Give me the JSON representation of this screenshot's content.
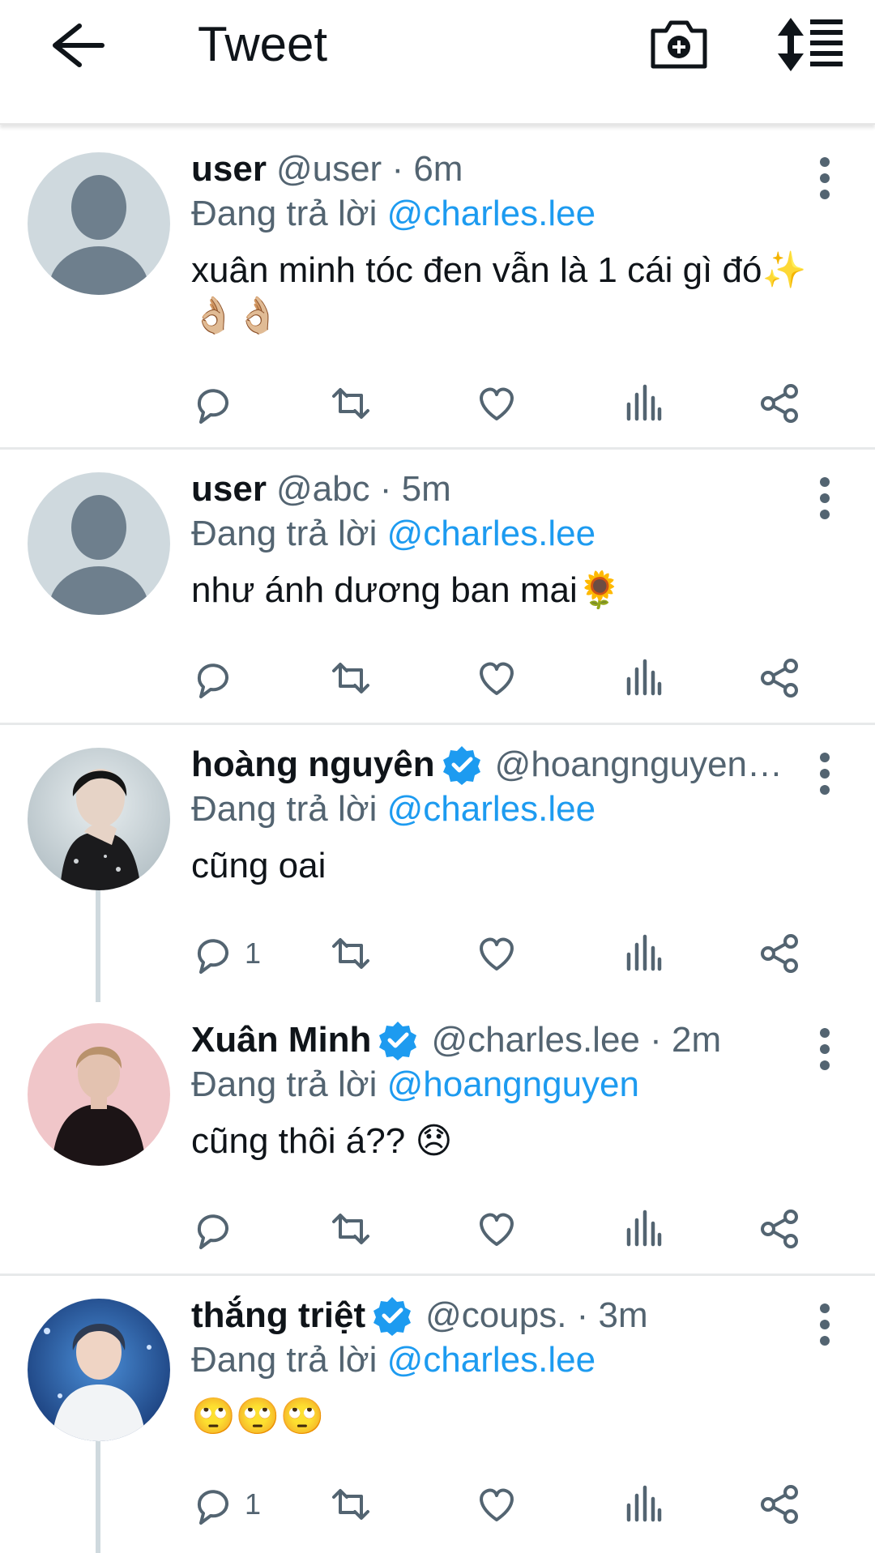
{
  "header": {
    "title": "Tweet",
    "back_icon": "arrow-left-icon",
    "camera_icon": "camera-plus-icon",
    "sort_icon": "sort-list-icon"
  },
  "colors": {
    "accent": "#1d9bf0",
    "secondary_text": "#536471",
    "primary_text": "#0f1419",
    "divider": "#e7e9ea"
  },
  "tweets": [
    {
      "name": "user",
      "handle": "@user · 6m",
      "verified": false,
      "replying_prefix": "Đang trả lời",
      "replying_to": "@charles.lee",
      "text": "xuân minh tóc đen vẫn là 1 cái gì đó✨👌🏼👌🏼",
      "reply_count": "",
      "avatar": "default-avatar"
    },
    {
      "name": "user",
      "handle": "@abc · 5m",
      "verified": false,
      "replying_prefix": "Đang trả lời",
      "replying_to": "@charles.lee",
      "text": "như ánh dương ban mai🌻",
      "reply_count": "",
      "avatar": "default-avatar"
    },
    {
      "name": "hoàng nguyên",
      "handle": "@hoangnguyen…",
      "verified": true,
      "replying_prefix": "Đang trả lời",
      "replying_to": "@charles.lee",
      "text": "cũng oai",
      "reply_count": "1",
      "avatar": "photo-avatar"
    },
    {
      "name": "Xuân Minh",
      "handle": "@charles.lee · 2m",
      "verified": true,
      "replying_prefix": "Đang trả lời",
      "replying_to": "@hoangnguyen",
      "text": "cũng thôi á?? 😞",
      "reply_count": "",
      "avatar": "photo-avatar"
    },
    {
      "name": "thắng triệt",
      "handle": "@coups. · 3m",
      "verified": true,
      "replying_prefix": "Đang trả lời",
      "replying_to": "@charles.lee",
      "text": "🙄🙄🙄",
      "reply_count": "1",
      "avatar": "photo-avatar"
    }
  ]
}
